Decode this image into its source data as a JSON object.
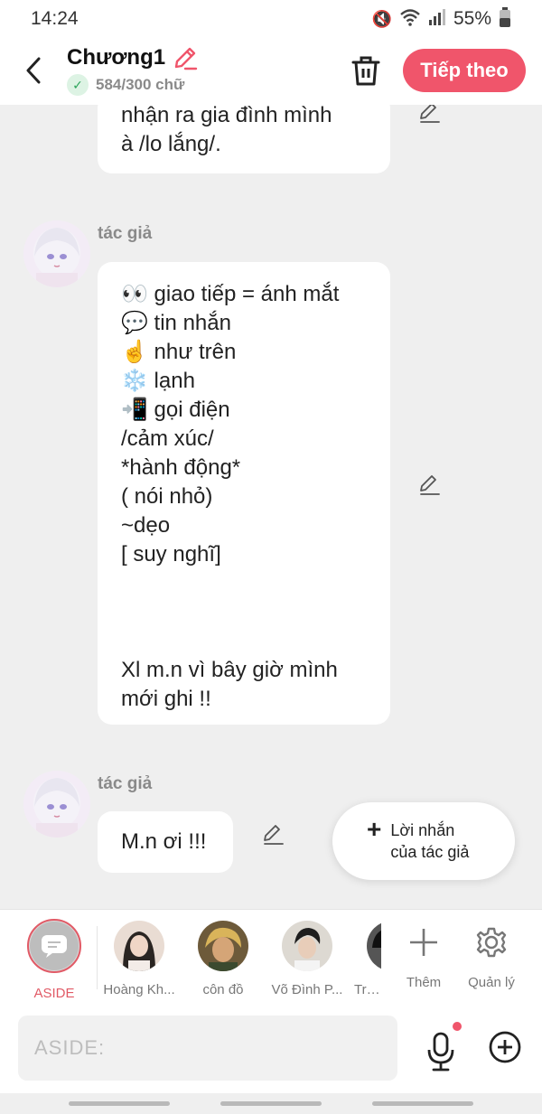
{
  "status": {
    "time": "14:24",
    "battery": "55%"
  },
  "header": {
    "title": "Chương1",
    "word_count": "584/300 chữ",
    "next_label": "Tiếp theo"
  },
  "messages": [
    {
      "author": "",
      "lines": [
        "nhận ra gia đình mình",
        "à /lo lắng/."
      ]
    },
    {
      "author": "tác giả",
      "lines": [
        "👀 giao tiếp = ánh mắt",
        "💬 tin nhắn",
        "☝️ như trên",
        "❄️ lạnh",
        "📲 gọi điện",
        "/cảm xúc/",
        "*hành động*",
        "( nói nhỏ)",
        "~dẹo",
        "[ suy nghĩ]",
        "",
        "",
        "",
        "Xl m.n vì bây giờ mình",
        "mới ghi !!"
      ]
    },
    {
      "author": "tác giả",
      "lines": [
        "M.n ơi !!!"
      ]
    }
  ],
  "author_note": {
    "line1": "Lời nhắn",
    "line2": "của tác giả"
  },
  "characters": [
    {
      "name": "ASIDE",
      "active": true
    },
    {
      "name": "Hoàng Kh..."
    },
    {
      "name": "côn đồ"
    },
    {
      "name": "Võ Đình P..."
    },
    {
      "name": "Trần"
    }
  ],
  "tools": {
    "add_label": "Thêm",
    "manage_label": "Quản lý"
  },
  "input": {
    "placeholder": "ASIDE:"
  },
  "colors": {
    "accent": "#f0556b",
    "aside_accent": "#e15a66",
    "verified": "#2ca55a"
  },
  "icons": [
    "back-icon",
    "pencil-icon",
    "check-icon",
    "trash-icon",
    "plus-icon",
    "gear-icon",
    "microphone-icon",
    "add-circle-icon",
    "chat-bubble-icon"
  ]
}
